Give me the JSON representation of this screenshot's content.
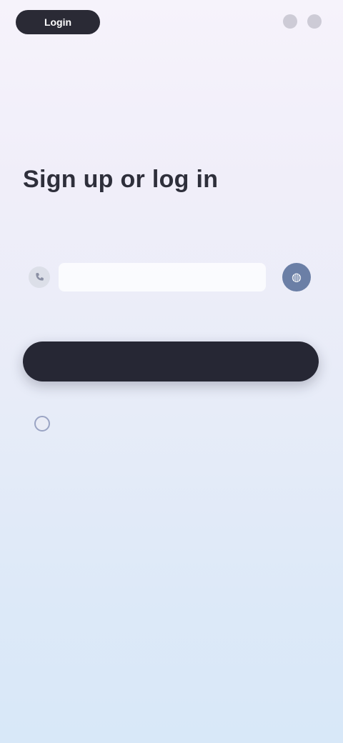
{
  "header": {
    "brand_label": "Login",
    "right_item_1": "",
    "right_item_2": ""
  },
  "main": {
    "title": "Sign up or log in",
    "subtitle": "",
    "input_placeholder": "",
    "cta_label": "",
    "consent_text": ""
  },
  "footer": {
    "text": ""
  },
  "colors": {
    "accent_dark": "#262734",
    "subtitle_green": "#3f9a6a",
    "language_button": "#6b7fa6"
  },
  "icons": {
    "input_icon": "phone-icon",
    "lang_icon": "globe-icon"
  }
}
